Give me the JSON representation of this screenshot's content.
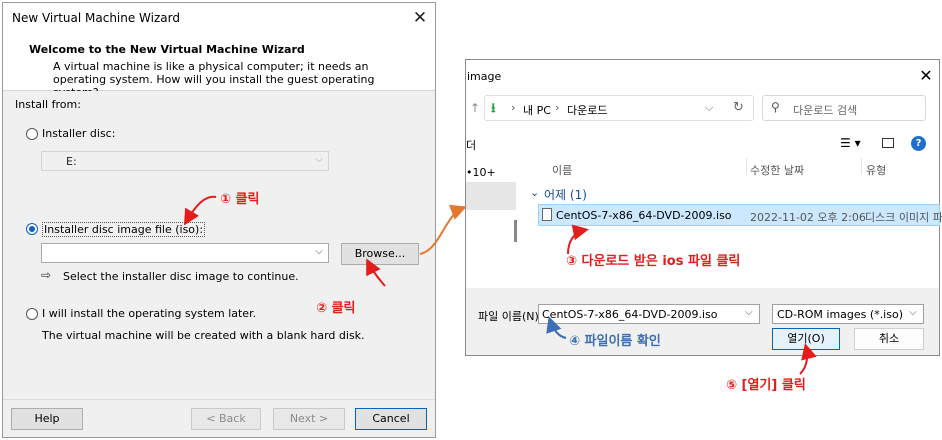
{
  "wizard": {
    "title": "New Virtual Machine Wizard",
    "heading": "Welcome to the New Virtual Machine Wizard",
    "description": "A virtual machine is like a physical computer; it needs an operating system. How will you install the guest operating system?",
    "install_from_label": "Install from:",
    "installer_disc_label": "Installer disc:",
    "installer_disc_value": "E:",
    "disc_image_label": "Installer disc image file (iso):",
    "disc_image_value": "",
    "browse_label": "Browse...",
    "hint_text": "Select the installer disc image to continue.",
    "later_label": "I will install the operating system later.",
    "later_desc": "The virtual machine will be created with a blank hard disk.",
    "selected_option": "disc_image",
    "buttons": {
      "help": "Help",
      "back": "< Back",
      "next": "Next >",
      "cancel": "Cancel"
    }
  },
  "dialog": {
    "title": "image",
    "breadcrumb": [
      "내 PC",
      "다운로드"
    ],
    "search_placeholder": "다운로드 검색",
    "nav_partial_1": "더",
    "nav_partial_2": "•10+",
    "columns": {
      "name": "이름",
      "modified": "수정한 날짜",
      "type": "유형"
    },
    "group": "어제 (1)",
    "file": {
      "name": "CentOS-7-x86_64-DVD-2009.iso",
      "modified": "2022-11-02 오후 2:06",
      "type": "디스크 이미지 파"
    },
    "filename_label": "파일 이름(N):",
    "filename_value": "CentOS-7-x86_64-DVD-2009.iso",
    "filter_value": "CD-ROM images (*.iso)",
    "open_label": "열기(O)",
    "cancel_label": "취소"
  },
  "annotations": {
    "a1": "① 클릭",
    "a2": "② 클릭",
    "a3": "③ 다운로드 받은 ios 파일 클릭",
    "a4": "④ 파일이름 확인",
    "a5": "⑤ [열기] 클릭"
  },
  "colors": {
    "annotation_red": "#e31c1c",
    "annotation_blue": "#3c6fb4",
    "selection": "#cce8ff",
    "accent": "#0a5fd0"
  }
}
